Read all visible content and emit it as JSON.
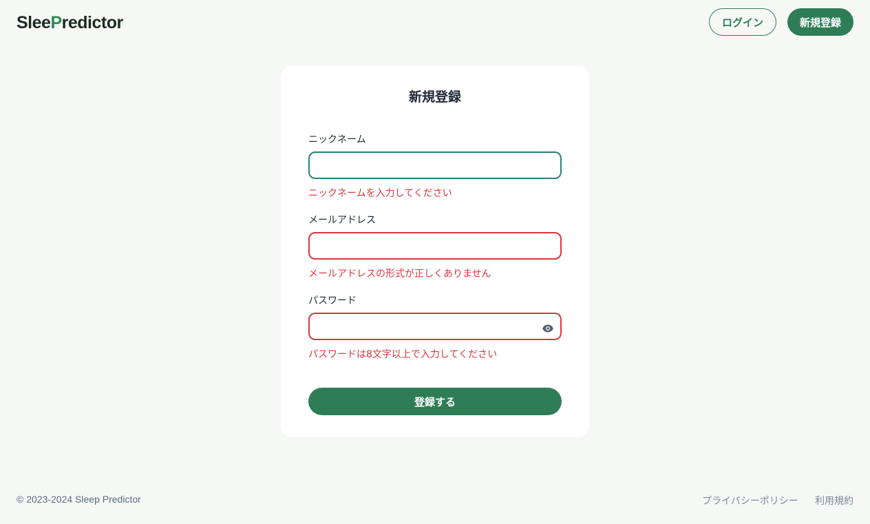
{
  "header": {
    "logo_text_start": "Slee",
    "logo_text_end": "redictor",
    "login_label": "ログイン",
    "signup_label": "新規登録"
  },
  "form": {
    "title": "新規登録",
    "nickname": {
      "label": "ニックネーム",
      "value": "",
      "error": "ニックネームを入力してください"
    },
    "email": {
      "label": "メールアドレス",
      "value": "",
      "error": "メールアドレスの形式が正しくありません"
    },
    "password": {
      "label": "パスワード",
      "value": "",
      "error": "パスワードは8文字以上で入力してください"
    },
    "submit_label": "登録する"
  },
  "footer": {
    "copyright": "© 2023-2024 Sleep Predictor",
    "privacy_label": "プライバシーポリシー",
    "terms_label": "利用規約"
  },
  "colors": {
    "brand": "#2e7d57",
    "error": "#d9363e",
    "focus": "#2a7f7a",
    "background": "#f6f8f6"
  }
}
